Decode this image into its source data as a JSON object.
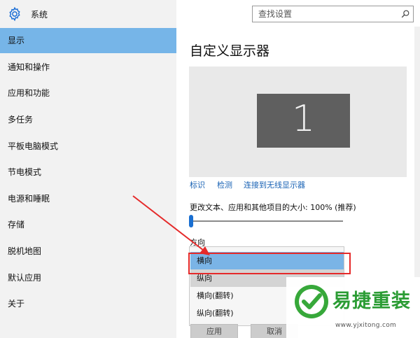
{
  "sidebar": {
    "title": "系统",
    "items": [
      {
        "label": "显示",
        "active": true
      },
      {
        "label": "通知和操作"
      },
      {
        "label": "应用和功能"
      },
      {
        "label": "多任务"
      },
      {
        "label": "平板电脑模式"
      },
      {
        "label": "节电模式"
      },
      {
        "label": "电源和睡眠"
      },
      {
        "label": "存储"
      },
      {
        "label": "脱机地图"
      },
      {
        "label": "默认应用"
      },
      {
        "label": "关于"
      }
    ]
  },
  "search": {
    "placeholder": "查找设置"
  },
  "main": {
    "title": "自定义显示器",
    "monitor_number": "1",
    "links": [
      "标识",
      "检测",
      "连接到无线显示器"
    ],
    "scale_label": "更改文本、应用和其他项目的大小: 100% (推荐)",
    "scale_value": 0,
    "orientation_label": "方向",
    "orientation_options": [
      {
        "label": "横向",
        "state": "selected"
      },
      {
        "label": "纵向",
        "state": "hover"
      },
      {
        "label": "横向(翻转)"
      },
      {
        "label": "纵向(翻转)"
      }
    ],
    "apply_label": "应用",
    "cancel_label": "取消"
  },
  "watermark": {
    "name": "易捷重装",
    "url": "www.yjxitong.com"
  },
  "colors": {
    "accent": "#76b5e8",
    "highlight": "#e52a2a",
    "brand": "#2b9c34"
  }
}
